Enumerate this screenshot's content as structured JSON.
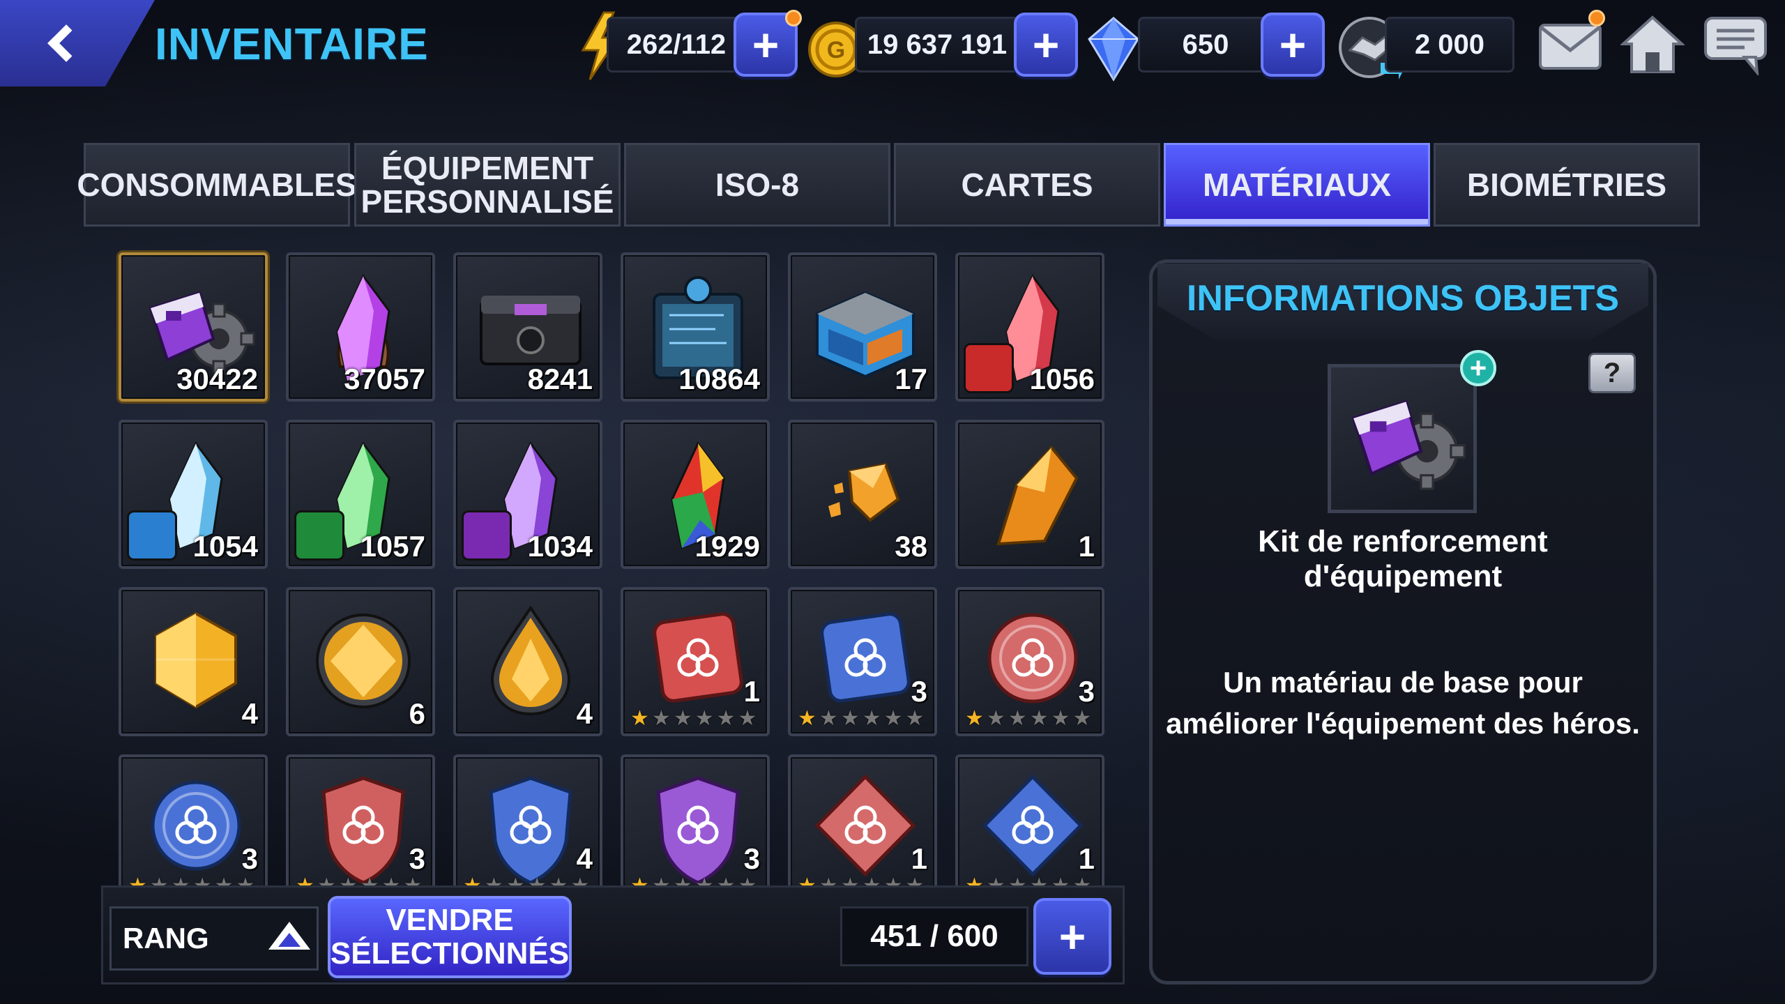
{
  "header": {
    "title": "INVENTAIRE",
    "energy": "262/112",
    "gold": "19 637 191",
    "crystals": "650",
    "alliance_tokens": "2 000"
  },
  "tabs": [
    {
      "label": "CONSOMMABLES",
      "active": false
    },
    {
      "label": "ÉQUIPEMENT\nPERSONNALISÉ",
      "active": false
    },
    {
      "label": "ISO-8",
      "active": false
    },
    {
      "label": "CARTES",
      "active": false
    },
    {
      "label": "MATÉRIAUX",
      "active": true
    },
    {
      "label": "BIOMÉTRIES",
      "active": false
    }
  ],
  "items": [
    {
      "icon": "gear-kit-icon",
      "qty": "30422"
    },
    {
      "icon": "purple-crystal-claw-icon",
      "qty": "37057"
    },
    {
      "icon": "black-chest-icon",
      "qty": "8241"
    },
    {
      "icon": "datapad-icon",
      "qty": "10864"
    },
    {
      "icon": "blue-crate-icon",
      "qty": "17"
    },
    {
      "icon": "red-crystal-combat-icon",
      "qty": "1056"
    },
    {
      "icon": "blue-crystal-blast-icon",
      "qty": "1054"
    },
    {
      "icon": "green-crystal-speed-icon",
      "qty": "1057"
    },
    {
      "icon": "purple-crystal-universal-icon",
      "qty": "1034"
    },
    {
      "icon": "rainbow-crystal-icon",
      "qty": "1929"
    },
    {
      "icon": "orange-fragments-icon",
      "qty": "38"
    },
    {
      "icon": "orange-crystal-icon",
      "qty": "1"
    },
    {
      "icon": "gold-hexagon-gem-icon",
      "qty": "4"
    },
    {
      "icon": "gold-round-gem-icon",
      "qty": "6"
    },
    {
      "icon": "gold-drop-gem-icon",
      "qty": "4"
    },
    {
      "icon": "red-square-rune-icon",
      "qty": "1",
      "stars": 1
    },
    {
      "icon": "blue-square-rune-icon",
      "qty": "3",
      "stars": 1
    },
    {
      "icon": "red-round-rune-icon",
      "qty": "3",
      "stars": 1
    },
    {
      "icon": "blue-round-rune-icon",
      "qty": "3",
      "stars": 1
    },
    {
      "icon": "red-shield-rune-icon",
      "qty": "3",
      "stars": 1
    },
    {
      "icon": "blue-shield-rune-icon",
      "qty": "4",
      "stars": 1
    },
    {
      "icon": "purple-shield-rune-icon",
      "qty": "3",
      "stars": 1
    },
    {
      "icon": "red-diamond-rune-icon",
      "qty": "1",
      "stars": 1
    },
    {
      "icon": "blue-diamond-rune-icon",
      "qty": "1",
      "stars": 1
    }
  ],
  "bottom": {
    "sort_label": "RANG",
    "sell_label": "VENDRE\nSÉLECTIONNÉS",
    "capacity": "451 / 600"
  },
  "info": {
    "title": "INFORMATIONS OBJETS",
    "item_name": "Kit de renforcement d'équipement",
    "description": "Un matériau de base pour\naméliorer l'équipement des héros.",
    "help": "?"
  },
  "colors": {
    "accent_blue": "#3ec3f7",
    "active_tab": "#3d2ed6",
    "star_gold": "#f5b524",
    "selected_border": "#b08a3a"
  }
}
